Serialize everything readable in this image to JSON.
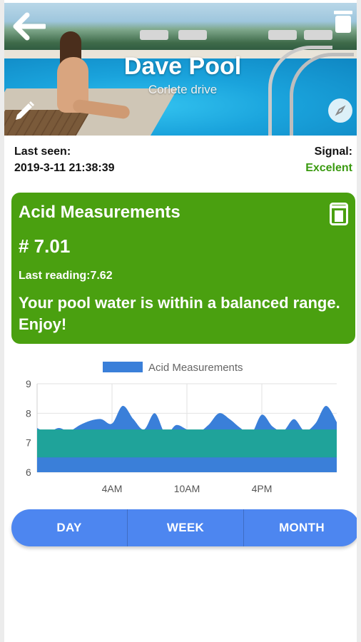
{
  "header": {
    "title": "Dave Pool",
    "subtitle": "Corlete drive",
    "back_icon": "back-arrow-icon",
    "delete_icon": "trash-icon",
    "edit_icon": "pencil-icon",
    "compass_icon": "compass-icon"
  },
  "status": {
    "last_seen_label": "Last seen:",
    "last_seen_value": "2019-3-11 21:38:39",
    "signal_label": "Signal:",
    "signal_value": "Excelent",
    "signal_color": "#3a9a10"
  },
  "card": {
    "title": "Acid Measurements",
    "value": "# 7.01",
    "last_reading": "Last reading:7.62",
    "message": "Your pool water is within a balanced range. Enjoy!",
    "background_color": "#4aa010",
    "delete_icon": "trash-icon"
  },
  "chart_data": {
    "type": "area",
    "legend": [
      "Acid Measurements"
    ],
    "legend_position": "top-center",
    "grid": true,
    "y_ticks": [
      "9",
      "8",
      "7",
      "6"
    ],
    "ylim": [
      6,
      9
    ],
    "x_ticks": [
      "4AM",
      "10AM",
      "4PM"
    ],
    "series": [
      {
        "name": "Acid Measurements",
        "color": "#3a7fd9",
        "values": [
          7.5,
          7.35,
          7.5,
          7.4,
          7.6,
          7.75,
          7.8,
          7.65,
          8.25,
          7.8,
          7.45,
          8.0,
          7.3,
          7.6,
          7.45,
          7.35,
          7.6,
          8.0,
          7.8,
          7.5,
          7.3,
          7.95,
          7.55,
          7.4,
          7.8,
          7.4,
          7.65,
          8.25,
          7.7
        ]
      }
    ],
    "bands": [
      {
        "color": "#b8f0a8",
        "value": 7.45
      },
      {
        "color": "#1fa39a",
        "value": 7.45
      },
      {
        "color": "#3a7fd9",
        "value": 6.5
      }
    ]
  },
  "range_selector": {
    "options": [
      "DAY",
      "WEEK",
      "MONTH"
    ],
    "color": "#4d86f0"
  }
}
